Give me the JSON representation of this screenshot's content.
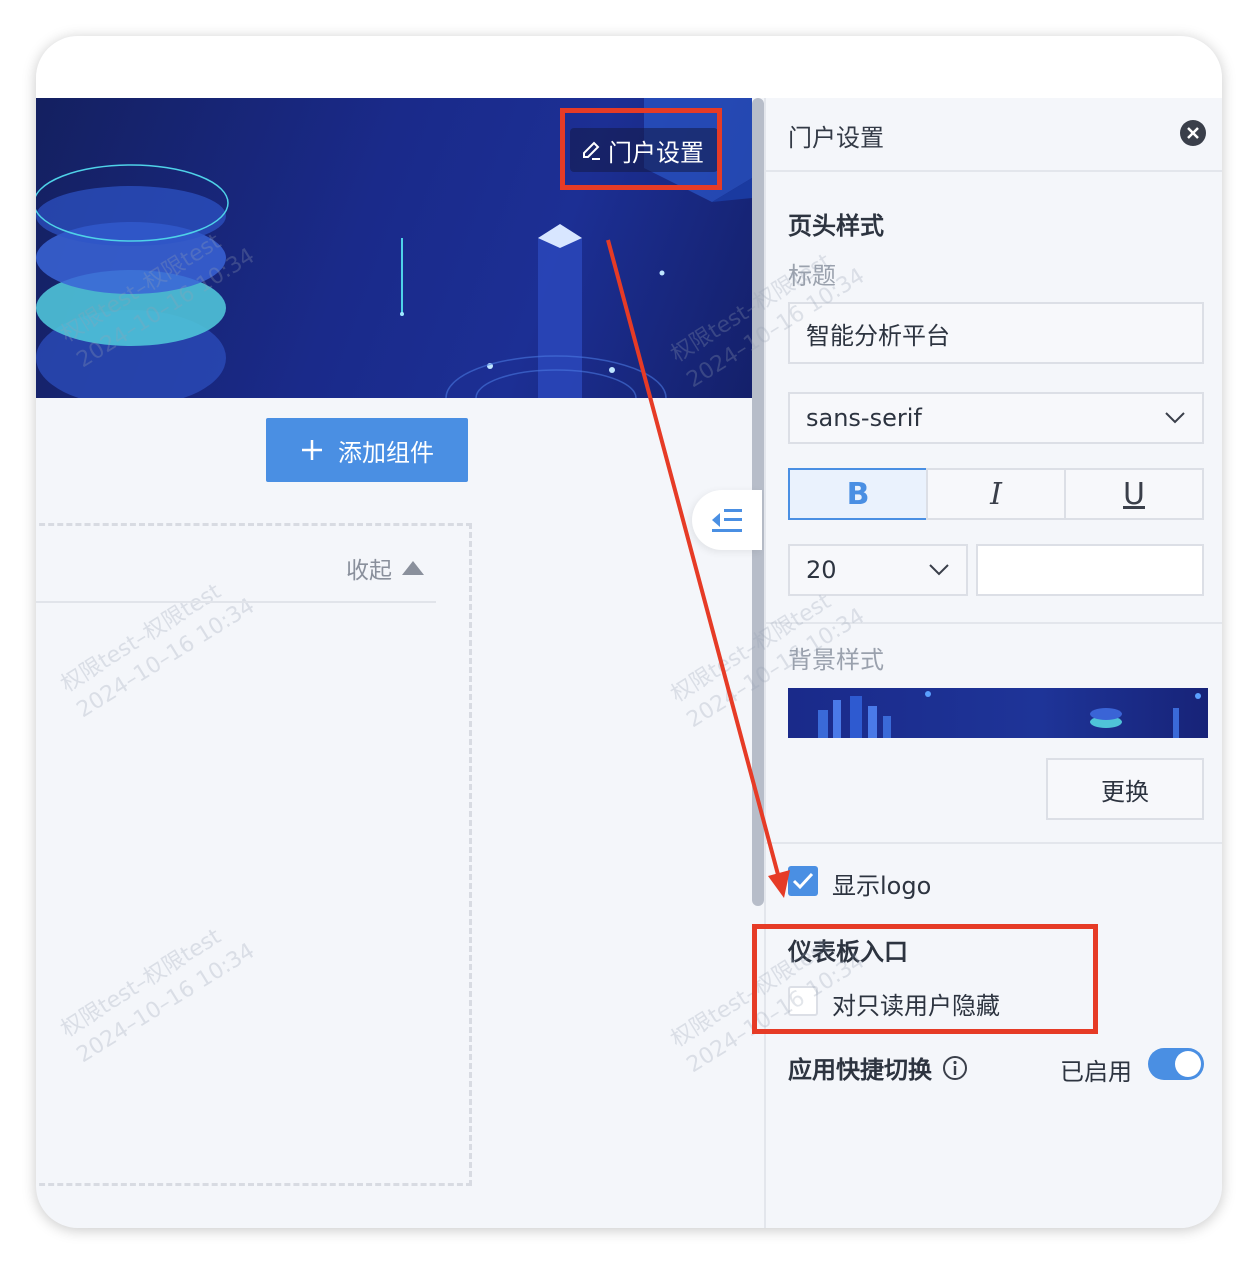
{
  "banner": {
    "portal_settings_label": "门户设置"
  },
  "toolbar": {
    "add_component_label": "添加组件"
  },
  "section": {
    "collapse_label": "收起"
  },
  "watermark": {
    "line1": "权限test–权限test",
    "line2": "2024–10–16 10:34"
  },
  "panel": {
    "title": "门户设置",
    "header_style_title": "页头样式",
    "title_label": "标题",
    "title_value": "智能分析平台",
    "font_family_value": "sans-serif",
    "bold_label": "B",
    "italic_label": "I",
    "underline_label": "U",
    "font_size_value": "20",
    "background_style_label": "背景样式",
    "change_button_label": "更换",
    "show_logo_label": "显示logo",
    "show_logo_checked": true,
    "dashboard_entry_title": "仪表板入口",
    "hide_readonly_label": "对只读用户隐藏",
    "hide_readonly_checked": false,
    "quick_switch_label": "应用快捷切换",
    "quick_switch_status": "已启用",
    "quick_switch_enabled": true
  },
  "colors": {
    "accent": "#4a8fe3",
    "annotation": "#e63b26",
    "banner": "#1a2a8a"
  },
  "icons": {
    "edit": "pencil-icon",
    "add": "plus-icon",
    "collapse": "triangle-up-icon",
    "fold": "outdent-icon",
    "close": "close-circle-icon",
    "info": "info-circle-icon",
    "dropdown": "chevron-down-icon"
  }
}
